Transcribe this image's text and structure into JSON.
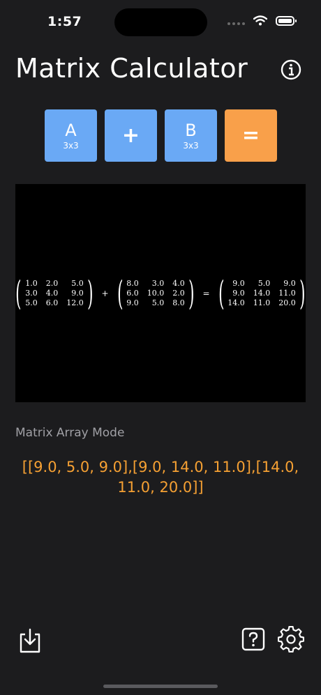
{
  "status": {
    "time": "1:57"
  },
  "header": {
    "title": "Matrix Calculator"
  },
  "buttons": {
    "a": {
      "label": "A",
      "sub": "3x3"
    },
    "op": {
      "label": "+"
    },
    "b": {
      "label": "B",
      "sub": "3x3"
    },
    "eq": {
      "label": "="
    }
  },
  "formula": {
    "a": [
      [
        "1.0",
        "2.0",
        "5.0"
      ],
      [
        "3.0",
        "4.0",
        "9.0"
      ],
      [
        "5.0",
        "6.0",
        "12.0"
      ]
    ],
    "op": "+",
    "b": [
      [
        "8.0",
        "3.0",
        "4.0"
      ],
      [
        "6.0",
        "10.0",
        "2.0"
      ],
      [
        "9.0",
        "5.0",
        "8.0"
      ]
    ],
    "eq": "=",
    "result": [
      [
        "9.0",
        "5.0",
        "9.0"
      ],
      [
        "9.0",
        "14.0",
        "11.0"
      ],
      [
        "14.0",
        "11.0",
        "20.0"
      ]
    ]
  },
  "mode": {
    "label": "Matrix Array Mode"
  },
  "array_text": "[[9.0, 5.0, 9.0],[9.0, 14.0, 11.0],[14.0, 11.0, 20.0]]",
  "colors": {
    "background": "#1c1c1e",
    "blue_button": "#6aa9f5",
    "orange_button": "#f9a04a",
    "result_text": "#f5a033"
  },
  "icons": {
    "info": "info-circle-icon",
    "download": "download-tray-icon",
    "help": "question-square-icon",
    "settings": "gear-icon"
  }
}
